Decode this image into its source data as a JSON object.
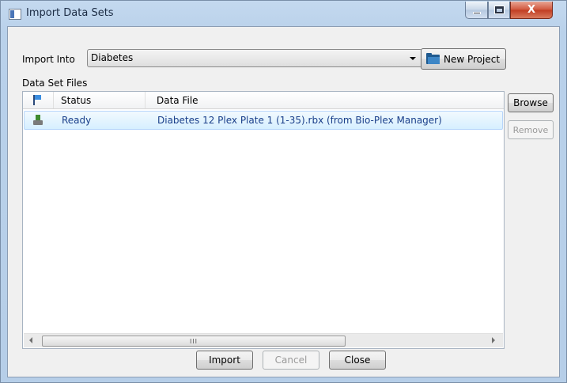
{
  "window": {
    "title": "Import Data Sets",
    "close_glyph": "X"
  },
  "import_into": {
    "label": "Import Into",
    "selected": "Diabetes"
  },
  "new_project": {
    "label": "New Project"
  },
  "files": {
    "label": "Data Set Files",
    "columns": {
      "status": "Status",
      "data_file": "Data File"
    },
    "rows": [
      {
        "status": "Ready",
        "data_file": "Diabetes 12 Plex Plate 1 (1-35).rbx (from Bio-Plex Manager)"
      }
    ],
    "scroll_thumb_grip": "III"
  },
  "side_buttons": {
    "browse": "Browse",
    "remove": "Remove"
  },
  "footer": {
    "import": "Import",
    "cancel": "Cancel",
    "close": "Close"
  },
  "colors": {
    "selection_text": "#1a3f8a",
    "folder_icon": "#1f5a8f"
  }
}
